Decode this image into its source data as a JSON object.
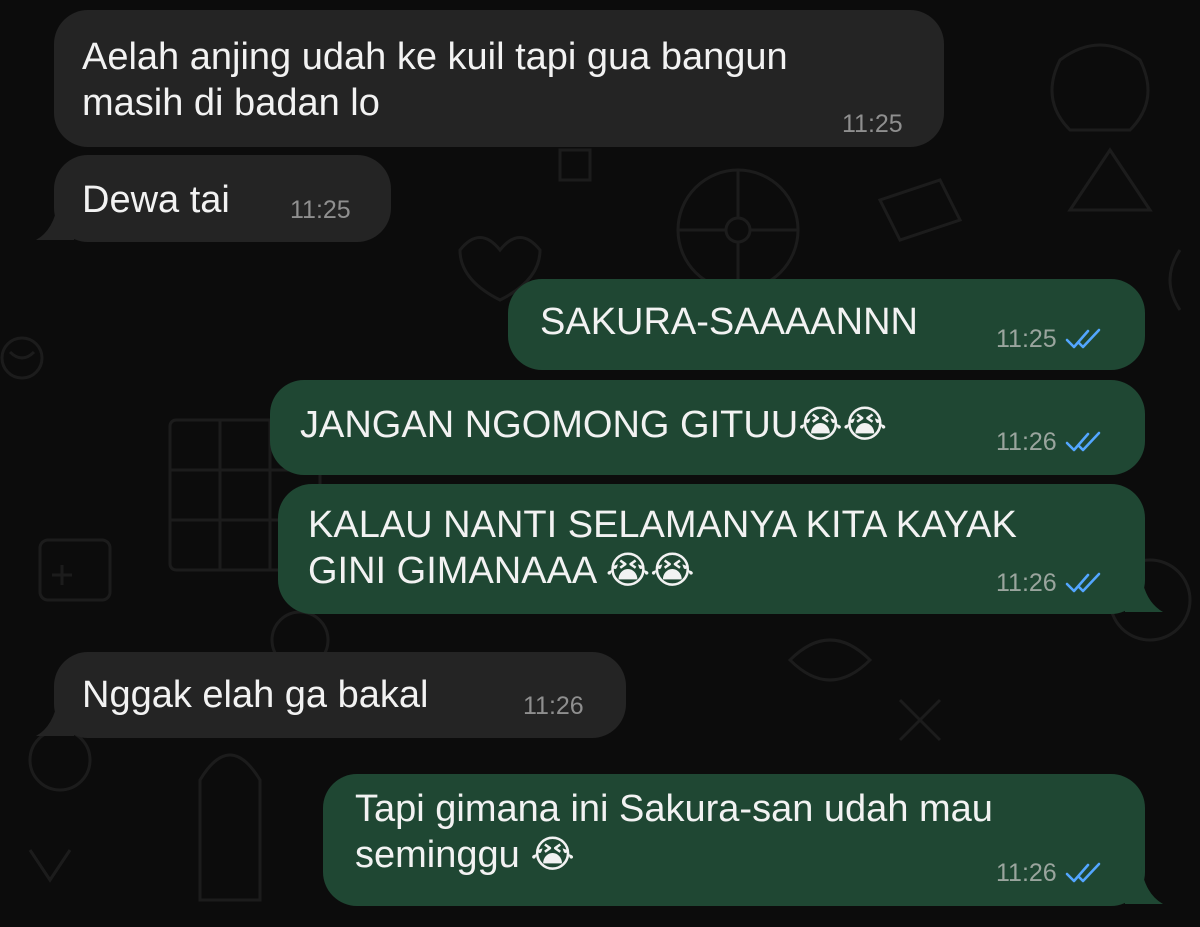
{
  "colors": {
    "incoming_bubble": "#242424",
    "outgoing_bubble": "#1f4733",
    "read_ticks": "#53a6ff",
    "background": "#0c0c0c"
  },
  "messages": [
    {
      "direction": "incoming",
      "lines": [
        "Aelah anjing udah ke kuil tapi gua bangun",
        "masih di badan lo"
      ],
      "time": "11:25"
    },
    {
      "direction": "incoming",
      "lines": [
        "Dewa tai"
      ],
      "time": "11:25"
    },
    {
      "direction": "outgoing",
      "lines": [
        "SAKURA-SAAAANNN"
      ],
      "time": "11:25",
      "status": "read-double-tick-icon"
    },
    {
      "direction": "outgoing",
      "lines": [
        "JANGAN NGOMONG GITUU😭😭"
      ],
      "time": "11:26",
      "status": "read-double-tick-icon"
    },
    {
      "direction": "outgoing",
      "lines": [
        "KALAU NANTI SELAMANYA KITA KAYAK",
        "GINI GIMANAAA 😭😭"
      ],
      "time": "11:26",
      "status": "read-double-tick-icon"
    },
    {
      "direction": "incoming",
      "lines": [
        "Nggak elah ga bakal"
      ],
      "time": "11:26"
    },
    {
      "direction": "outgoing",
      "lines": [
        "Tapi gimana ini Sakura-san udah mau",
        "seminggu 😭"
      ],
      "time": "11:26",
      "status": "read-double-tick-icon"
    }
  ]
}
